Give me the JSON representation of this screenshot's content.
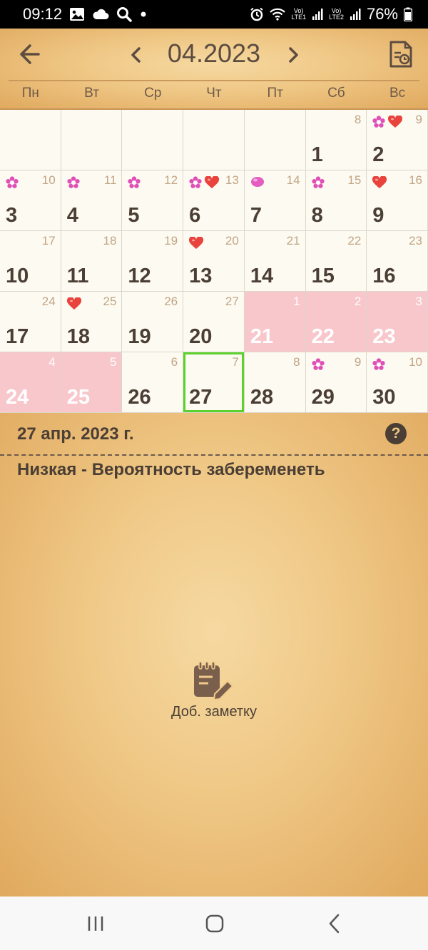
{
  "status_bar": {
    "time": "09:12",
    "battery": "76%",
    "sim1": "LTE1",
    "sim2": "LTE2",
    "volte": "Vo)"
  },
  "header": {
    "month_title": "04.2023",
    "weekdays": [
      "Пн",
      "Вт",
      "Ср",
      "Чт",
      "Пт",
      "Сб",
      "Вс"
    ]
  },
  "calendar": {
    "weeks": [
      [
        {
          "day": "",
          "cycle": "",
          "icons": []
        },
        {
          "day": "",
          "cycle": "",
          "icons": []
        },
        {
          "day": "",
          "cycle": "",
          "icons": []
        },
        {
          "day": "",
          "cycle": "",
          "icons": []
        },
        {
          "day": "",
          "cycle": "",
          "icons": []
        },
        {
          "day": "1",
          "cycle": "8",
          "icons": []
        },
        {
          "day": "2",
          "cycle": "9",
          "icons": [
            "flower-icon",
            "heart-icon"
          ]
        }
      ],
      [
        {
          "day": "3",
          "cycle": "10",
          "icons": [
            "flower-icon"
          ]
        },
        {
          "day": "4",
          "cycle": "11",
          "icons": [
            "flower-icon"
          ]
        },
        {
          "day": "5",
          "cycle": "12",
          "icons": [
            "flower-icon"
          ]
        },
        {
          "day": "6",
          "cycle": "13",
          "icons": [
            "flower-icon",
            "heart-icon"
          ]
        },
        {
          "day": "7",
          "cycle": "14",
          "icons": [
            "ovulation-egg-icon"
          ]
        },
        {
          "day": "8",
          "cycle": "15",
          "icons": [
            "flower-icon"
          ]
        },
        {
          "day": "9",
          "cycle": "16",
          "icons": [
            "heart-icon"
          ]
        }
      ],
      [
        {
          "day": "10",
          "cycle": "17",
          "icons": []
        },
        {
          "day": "11",
          "cycle": "18",
          "icons": []
        },
        {
          "day": "12",
          "cycle": "19",
          "icons": []
        },
        {
          "day": "13",
          "cycle": "20",
          "icons": [
            "heart-icon"
          ]
        },
        {
          "day": "14",
          "cycle": "21",
          "icons": []
        },
        {
          "day": "15",
          "cycle": "22",
          "icons": []
        },
        {
          "day": "16",
          "cycle": "23",
          "icons": []
        }
      ],
      [
        {
          "day": "17",
          "cycle": "24",
          "icons": []
        },
        {
          "day": "18",
          "cycle": "25",
          "icons": [
            "heart-icon"
          ]
        },
        {
          "day": "19",
          "cycle": "26",
          "icons": []
        },
        {
          "day": "20",
          "cycle": "27",
          "icons": []
        },
        {
          "day": "21",
          "cycle": "1",
          "icons": [],
          "period": true
        },
        {
          "day": "22",
          "cycle": "2",
          "icons": [],
          "period": true
        },
        {
          "day": "23",
          "cycle": "3",
          "icons": [],
          "period": true
        }
      ],
      [
        {
          "day": "24",
          "cycle": "4",
          "icons": [],
          "period": true
        },
        {
          "day": "25",
          "cycle": "5",
          "icons": [],
          "period": true
        },
        {
          "day": "26",
          "cycle": "6",
          "icons": []
        },
        {
          "day": "27",
          "cycle": "7",
          "icons": [],
          "selected": true
        },
        {
          "day": "28",
          "cycle": "8",
          "icons": []
        },
        {
          "day": "29",
          "cycle": "9",
          "icons": [
            "flower-icon"
          ]
        },
        {
          "day": "30",
          "cycle": "10",
          "icons": [
            "flower-icon"
          ]
        }
      ]
    ]
  },
  "details": {
    "date": "27 апр. 2023 г.",
    "help": "?",
    "fertility": "Низкая - Вероятность забеременеть",
    "add_note_label": "Доб. заметку"
  },
  "colors": {
    "period": "#f8c7cb",
    "selected_border": "#5ad12d",
    "text_dark": "#4a3e35",
    "cycle_number": "#c0a585"
  }
}
